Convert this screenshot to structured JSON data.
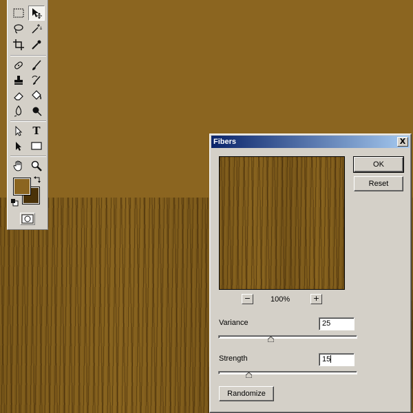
{
  "colors": {
    "canvas_background": "#8b6520",
    "foreground_color": "#8b6520",
    "background_color": "#4a3208",
    "titlebar_start": "#0a246a",
    "titlebar_end": "#a6caf0"
  },
  "toolbox": {
    "tools": [
      {
        "name": "rectangular-marquee-icon",
        "glyph": "⬚"
      },
      {
        "name": "move-icon",
        "glyph": "✥"
      },
      {
        "name": "lasso-icon",
        "glyph": "➰"
      },
      {
        "name": "magic-wand-icon",
        "glyph": "✧"
      },
      {
        "name": "crop-icon",
        "glyph": "⌗"
      },
      {
        "name": "eyedropper-icon",
        "glyph": "✎"
      },
      {
        "name": "healing-brush-icon",
        "glyph": "✚"
      },
      {
        "name": "brush-icon",
        "glyph": "✐"
      },
      {
        "name": "clone-stamp-icon",
        "glyph": "♜"
      },
      {
        "name": "history-brush-icon",
        "glyph": "↺"
      },
      {
        "name": "eraser-icon",
        "glyph": "▱"
      },
      {
        "name": "paint-bucket-icon",
        "glyph": "◈"
      },
      {
        "name": "blur-icon",
        "glyph": "◆"
      },
      {
        "name": "dodge-icon",
        "glyph": "●"
      },
      {
        "name": "path-selection-icon",
        "glyph": "↖"
      },
      {
        "name": "type-icon",
        "glyph": "T"
      },
      {
        "name": "direct-selection-icon",
        "glyph": "➤"
      },
      {
        "name": "rectangle-shape-icon",
        "glyph": "□"
      },
      {
        "name": "hand-icon",
        "glyph": "✋"
      },
      {
        "name": "zoom-icon",
        "glyph": "🔍"
      }
    ]
  },
  "dialog": {
    "title": "Fibers",
    "close_label": "X",
    "ok_label": "OK",
    "reset_label": "Reset",
    "zoom_minus": "−",
    "zoom_plus": "+",
    "zoom_level": "100%",
    "variance": {
      "label": "Variance",
      "value": "25",
      "slider_fraction": 0.38
    },
    "strength": {
      "label": "Strength",
      "value": "15",
      "slider_fraction": 0.22
    },
    "randomize_label": "Randomize"
  }
}
